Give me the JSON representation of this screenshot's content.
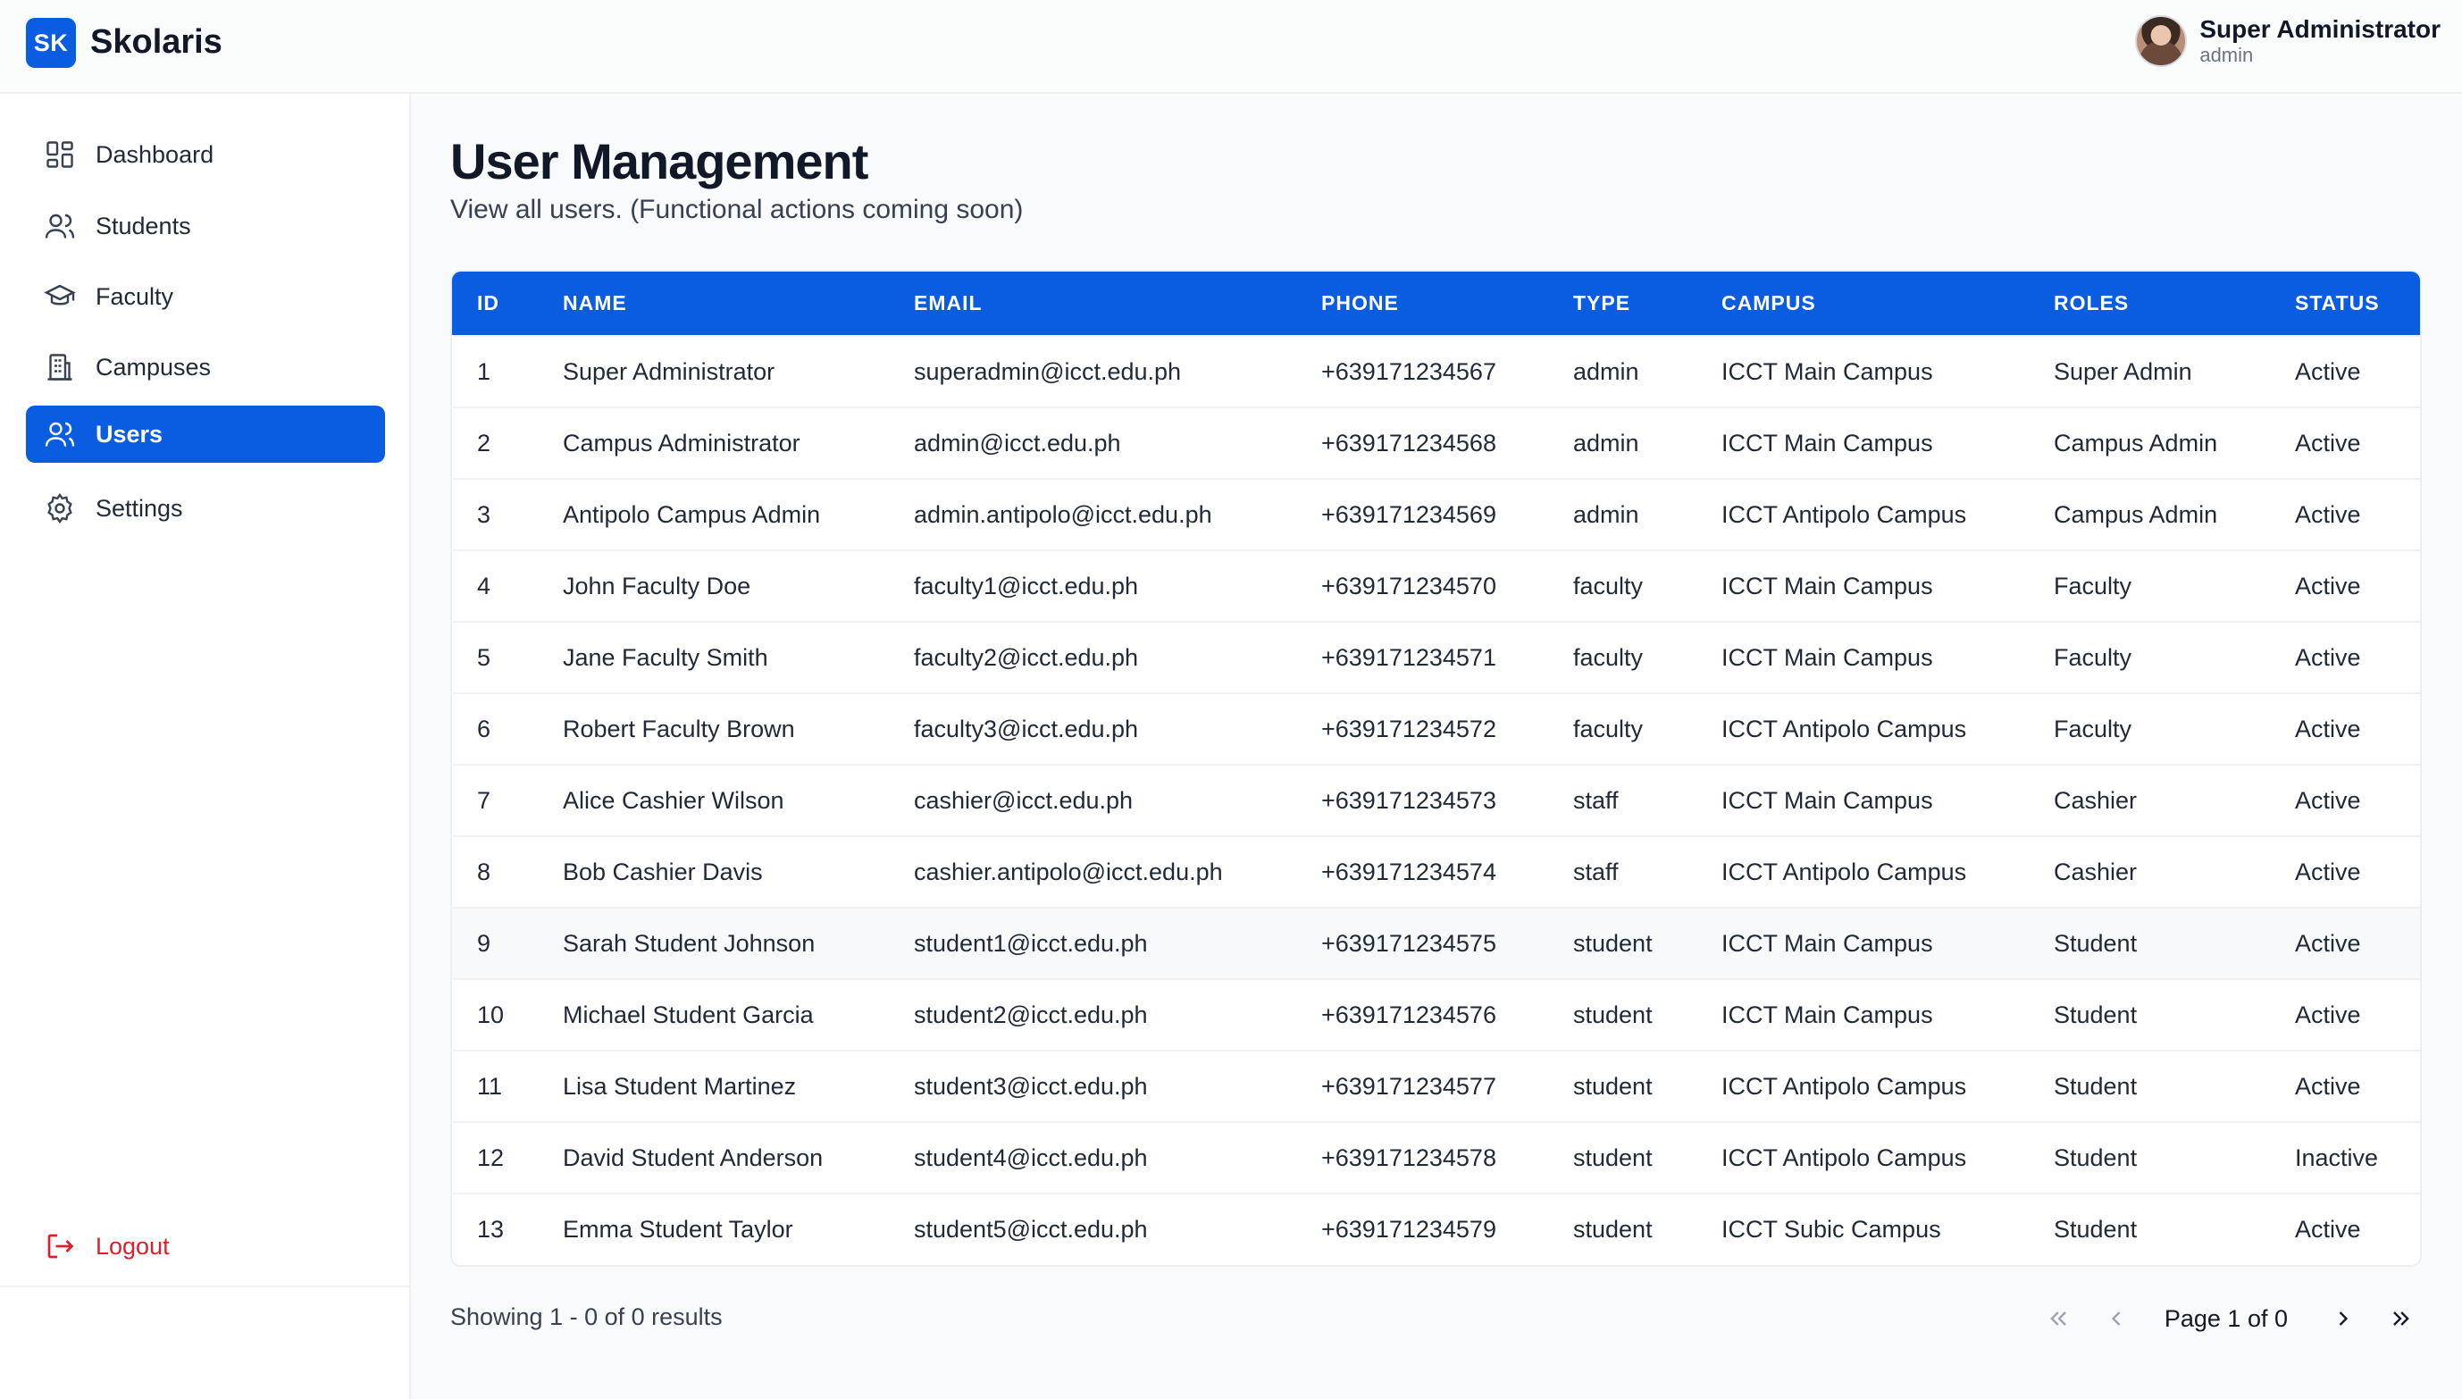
{
  "app": {
    "logo": "SK",
    "name": "Skolaris"
  },
  "user": {
    "name": "Super Administrator",
    "role": "admin"
  },
  "sidebar": {
    "items": [
      {
        "label": "Dashboard",
        "icon": "dashboard-icon"
      },
      {
        "label": "Students",
        "icon": "users-icon"
      },
      {
        "label": "Faculty",
        "icon": "graduation-cap-icon"
      },
      {
        "label": "Campuses",
        "icon": "building-icon"
      },
      {
        "label": "Users",
        "icon": "users-icon",
        "active": true
      },
      {
        "label": "Settings",
        "icon": "gear-icon"
      }
    ],
    "logout": "Logout"
  },
  "page": {
    "title": "User Management",
    "subtitle": "View all users. (Functional actions coming soon)"
  },
  "table": {
    "columns": [
      "ID",
      "NAME",
      "EMAIL",
      "PHONE",
      "TYPE",
      "CAMPUS",
      "ROLES",
      "STATUS"
    ],
    "rows": [
      [
        "1",
        "Super Administrator",
        "superadmin@icct.edu.ph",
        "+639171234567",
        "admin",
        "ICCT Main Campus",
        "Super Admin",
        "Active"
      ],
      [
        "2",
        "Campus Administrator",
        "admin@icct.edu.ph",
        "+639171234568",
        "admin",
        "ICCT Main Campus",
        "Campus Admin",
        "Active"
      ],
      [
        "3",
        "Antipolo Campus Admin",
        "admin.antipolo@icct.edu.ph",
        "+639171234569",
        "admin",
        "ICCT Antipolo Campus",
        "Campus Admin",
        "Active"
      ],
      [
        "4",
        "John Faculty Doe",
        "faculty1@icct.edu.ph",
        "+639171234570",
        "faculty",
        "ICCT Main Campus",
        "Faculty",
        "Active"
      ],
      [
        "5",
        "Jane Faculty Smith",
        "faculty2@icct.edu.ph",
        "+639171234571",
        "faculty",
        "ICCT Main Campus",
        "Faculty",
        "Active"
      ],
      [
        "6",
        "Robert Faculty Brown",
        "faculty3@icct.edu.ph",
        "+639171234572",
        "faculty",
        "ICCT Antipolo Campus",
        "Faculty",
        "Active"
      ],
      [
        "7",
        "Alice Cashier Wilson",
        "cashier@icct.edu.ph",
        "+639171234573",
        "staff",
        "ICCT Main Campus",
        "Cashier",
        "Active"
      ],
      [
        "8",
        "Bob Cashier Davis",
        "cashier.antipolo@icct.edu.ph",
        "+639171234574",
        "staff",
        "ICCT Antipolo Campus",
        "Cashier",
        "Active"
      ],
      [
        "9",
        "Sarah Student Johnson",
        "student1@icct.edu.ph",
        "+639171234575",
        "student",
        "ICCT Main Campus",
        "Student",
        "Active"
      ],
      [
        "10",
        "Michael Student Garcia",
        "student2@icct.edu.ph",
        "+639171234576",
        "student",
        "ICCT Main Campus",
        "Student",
        "Active"
      ],
      [
        "11",
        "Lisa Student Martinez",
        "student3@icct.edu.ph",
        "+639171234577",
        "student",
        "ICCT Antipolo Campus",
        "Student",
        "Active"
      ],
      [
        "12",
        "David Student Anderson",
        "student4@icct.edu.ph",
        "+639171234578",
        "student",
        "ICCT Antipolo Campus",
        "Student",
        "Inactive"
      ],
      [
        "13",
        "Emma Student Taylor",
        "student5@icct.edu.ph",
        "+639171234579",
        "student",
        "ICCT Subic Campus",
        "Student",
        "Active"
      ]
    ]
  },
  "footer": {
    "showing": "Showing 1 - 0 of 0 results",
    "page_label": "Page 1 of 0"
  },
  "colors": {
    "accent": "#0a5ce0",
    "logout": "#dc1f2b"
  }
}
